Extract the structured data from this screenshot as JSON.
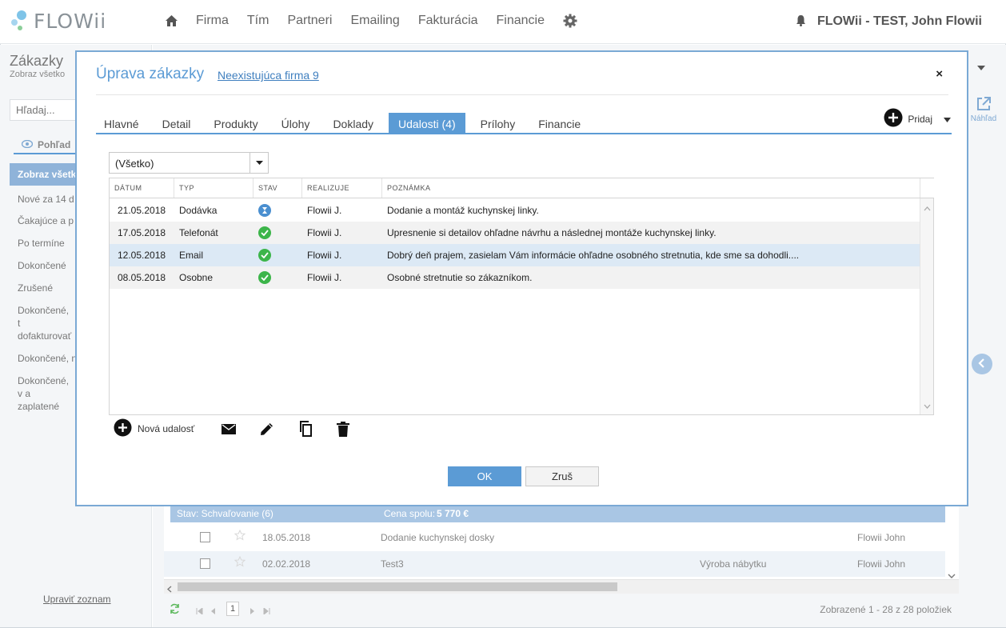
{
  "app": {
    "logo_text": "FLOWii",
    "brand_color": "#5b9bd5"
  },
  "nav": {
    "items": [
      "Firma",
      "Tím",
      "Partneri",
      "Emailing",
      "Fakturácia",
      "Financie"
    ],
    "user_name": "FLOWii - TEST, John Flowii"
  },
  "sidebar": {
    "title": "Zákazky",
    "subtitle": "Zobraz všetko",
    "search_placeholder": "Hľadaj...",
    "view_label": "Pohľad",
    "items": [
      "Zobraz všetk",
      "Nové za 14 d",
      "Čakajúce a p",
      "Po termíne",
      "Dokončené",
      "Zrušené",
      "Dokončené, t dofakturovať",
      "Dokončené, n",
      "Dokončené, v a zaplatené"
    ],
    "footer_link": "Upraviť zoznam"
  },
  "right_panel": {
    "preview_label": "Náhľad"
  },
  "background_list": {
    "group": {
      "status": "Stav: Schvaľovanie (6)",
      "total_label": "Cena spolu:",
      "total_value": "5 770 €"
    },
    "rows": [
      {
        "date": "18.05.2018",
        "name": "Dodanie kuchynskej dosky",
        "category": "",
        "owner": "Flowii John"
      },
      {
        "date": "02.02.2018",
        "name": "Test3",
        "category": "Výroba nábytku",
        "owner": "Flowii John"
      }
    ],
    "pager": {
      "page": "1",
      "count_text": "Zobrazené 1 - 28 z 28 položiek"
    }
  },
  "modal": {
    "title": "Úprava zákazky",
    "firm_link": "Neexistujúca firma 9",
    "tabs": [
      {
        "label": "Hlavné",
        "active": false
      },
      {
        "label": "Detail",
        "active": false
      },
      {
        "label": "Produkty",
        "active": false
      },
      {
        "label": "Úlohy",
        "active": false
      },
      {
        "label": "Doklady",
        "active": false
      },
      {
        "label": "Udalosti (4)",
        "active": true
      },
      {
        "label": "Prílohy",
        "active": false
      },
      {
        "label": "Financie",
        "active": false
      }
    ],
    "add_label": "Pridaj",
    "filter_value": "(Všetko)",
    "columns": [
      "DÁTUM",
      "TYP",
      "STAV",
      "REALIZUJE",
      "POZNÁMKA"
    ],
    "rows": [
      {
        "date": "21.05.2018",
        "type": "Dodávka",
        "status": "pending",
        "assignee": "Flowii J.",
        "note": "Dodanie a montáž kuchynskej linky."
      },
      {
        "date": "17.05.2018",
        "type": "Telefonát",
        "status": "done",
        "assignee": "Flowii J.",
        "note": "Upresnenie si detailov ohľadne návrhu a následnej montáže kuchynskej linky."
      },
      {
        "date": "12.05.2018",
        "type": "Email",
        "status": "done",
        "assignee": "Flowii J.",
        "note": "Dobrý deň prajem, zasielam Vám informácie ohľadne osobného stretnutia, kde sme sa dohodli...."
      },
      {
        "date": "08.05.2018",
        "type": "Osobne",
        "status": "done",
        "assignee": "Flowii J.",
        "note": "Osobné stretnutie so zákazníkom."
      }
    ],
    "toolbar": {
      "new_event_label": "Nová udalosť"
    },
    "ok_label": "OK",
    "cancel_label": "Zruš"
  }
}
